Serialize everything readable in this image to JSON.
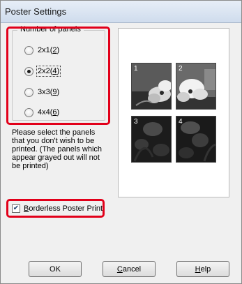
{
  "window": {
    "title": "Poster Settings"
  },
  "panels_group": {
    "legend": "Number of panels",
    "options": [
      {
        "text": "2x1(",
        "key": "2",
        "suffix": ")",
        "checked": false
      },
      {
        "text": "2x2(",
        "key": "4",
        "suffix": ")",
        "checked": true
      },
      {
        "text": "3x3(",
        "key": "9",
        "suffix": ")",
        "checked": false
      },
      {
        "text": "4x4(",
        "key": "6",
        "suffix": ")",
        "checked": false
      }
    ]
  },
  "instructions": "Please select the panels that you don't wish to be printed. (The panels which appear grayed out will not be printed)",
  "borderless": {
    "label_key": "B",
    "label_rest": "orderless Poster Print",
    "checked": true,
    "check_glyph": "✔"
  },
  "preview": {
    "panels": [
      {
        "number": "1",
        "active": true
      },
      {
        "number": "2",
        "active": true
      },
      {
        "number": "3",
        "active": false
      },
      {
        "number": "4",
        "active": false
      }
    ]
  },
  "buttons": {
    "ok": "OK",
    "cancel_key": "C",
    "cancel_rest": "ancel",
    "help_key": "H",
    "help_rest": "elp"
  },
  "colors": {
    "highlight": "#e2001a",
    "dialog_bg": "#f0f0f0"
  }
}
